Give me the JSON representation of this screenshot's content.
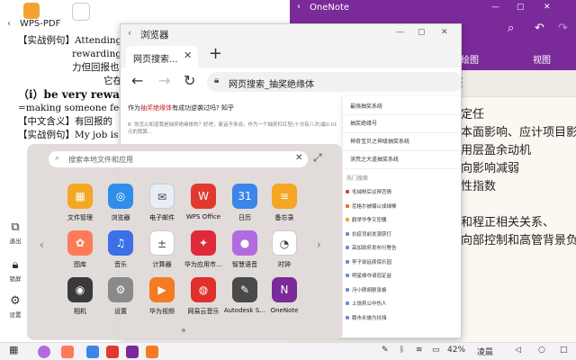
{
  "wps": {
    "title": "WPS-PDF",
    "lines": [
      "【实战例句】Attending a",
      "rewarding p",
      "力但回报也",
      "它在",
      "（i）be very rewardi",
      "=making someone feel sati",
      "【中文含义】有回报的",
      "【实战例句】My job is"
    ]
  },
  "onenote": {
    "title": "OneNote",
    "tab_left": "绘图",
    "tab_right": "视图",
    "notes": [
      "定任",
      "本面影响、应计项目影",
      "用层盈余动机",
      "向影响减弱",
      "性指数",
      "",
      "和程正相关关系、",
      "向部控制和高管背景负向"
    ]
  },
  "browser": {
    "window_title": "浏览器",
    "tab_label": "网页搜索...",
    "url": "网页搜索_抽奖绝缘体",
    "question": "作为抽奖绝缘体有成功逆袭过吗? 知乎",
    "question_highlight": "抽奖绝缘体",
    "snippet": "8. 你怎么知道我是抽奖绝缘体的？好吧，废话不多说。作为一个抽奖杠红型(十次有八次)最0.01元的我算…",
    "suggestions": [
      "最强抽奖系统",
      "抽奖绝缘号",
      "神奇宝贝之神级抽奖系统",
      "洪荒之大道抽奖系统"
    ],
    "hot_label": "热门搜索",
    "hot_items": [
      {
        "text": "毛绒粉后议辨恋情",
        "color": "#e04040"
      },
      {
        "text": "尼格尔被曝认成绿棒",
        "color": "#f07030"
      },
      {
        "text": "鹤举华争又犯骚",
        "color": "#f0a030"
      },
      {
        "text": "抗疫背前发源获打",
        "color": "#6b8fd6"
      },
      {
        "text": "高加政府发布行警告",
        "color": "#6b8fd6"
      },
      {
        "text": "李子柒延续保乐园",
        "color": "#6b8fd6"
      },
      {
        "text": "明星维夺请冠定益",
        "color": "#6b8fd6"
      },
      {
        "text": "冯小刚胡剧张格",
        "color": "#6b8fd6"
      },
      {
        "text": "上饶莉公中伤人",
        "color": "#6b8fd6"
      },
      {
        "text": "鹅市永施为抗嗨",
        "color": "#6b8fd6"
      }
    ]
  },
  "drawer": {
    "search_placeholder": "搜索本地文件和应用",
    "apps": [
      {
        "label": "文件管理",
        "icon": "folder-icon",
        "color": "#f5a623",
        "glyph": "▦"
      },
      {
        "label": "浏览器",
        "icon": "browser-icon",
        "color": "#2f8ee8",
        "glyph": "◎"
      },
      {
        "label": "电子邮件",
        "icon": "mail-icon",
        "color": "#e8eef5",
        "glyph": "✉"
      },
      {
        "label": "WPS Office",
        "icon": "wps-icon",
        "color": "#e03a2f",
        "glyph": "W"
      },
      {
        "label": "日历",
        "icon": "calendar-icon",
        "color": "#3b86e8",
        "glyph": "31"
      },
      {
        "label": "备忘录",
        "icon": "memo-icon",
        "color": "#f5a623",
        "glyph": "≡"
      },
      {
        "label": "图库",
        "icon": "gallery-icon",
        "color": "#ff7b57",
        "glyph": "✿"
      },
      {
        "label": "音乐",
        "icon": "music-icon",
        "color": "#3c6fe8",
        "glyph": "♫"
      },
      {
        "label": "计算器",
        "icon": "calculator-icon",
        "color": "#ffffff",
        "glyph": "±"
      },
      {
        "label": "华为应用市…",
        "icon": "appgallery-icon",
        "color": "#e02a3a",
        "glyph": "✦"
      },
      {
        "label": "智慧语音",
        "icon": "voice-icon",
        "color": "#b26bde",
        "glyph": "●"
      },
      {
        "label": "时钟",
        "icon": "clock-icon",
        "color": "#ffffff",
        "glyph": "◔"
      },
      {
        "label": "相机",
        "icon": "camera-icon",
        "color": "#3a3a3a",
        "glyph": "◉"
      },
      {
        "label": "设置",
        "icon": "settings-icon",
        "color": "#8a8a8a",
        "glyph": "⚙"
      },
      {
        "label": "华为视频",
        "icon": "video-icon",
        "color": "#f57a24",
        "glyph": "▶"
      },
      {
        "label": "网易云音乐",
        "icon": "netease-music-icon",
        "color": "#e0302c",
        "glyph": "◍"
      },
      {
        "label": "Autodesk S…",
        "icon": "sketchbook-icon",
        "color": "#4a4a4a",
        "glyph": "✎"
      },
      {
        "label": "OneNote",
        "icon": "onenote-icon",
        "color": "#7b2a9a",
        "glyph": "N"
      }
    ]
  },
  "side": {
    "exit_label": "退出",
    "lock_label": "锁屏",
    "settings_label": "设置"
  },
  "taskbar": {
    "battery": "42%",
    "user": "凌晨"
  }
}
